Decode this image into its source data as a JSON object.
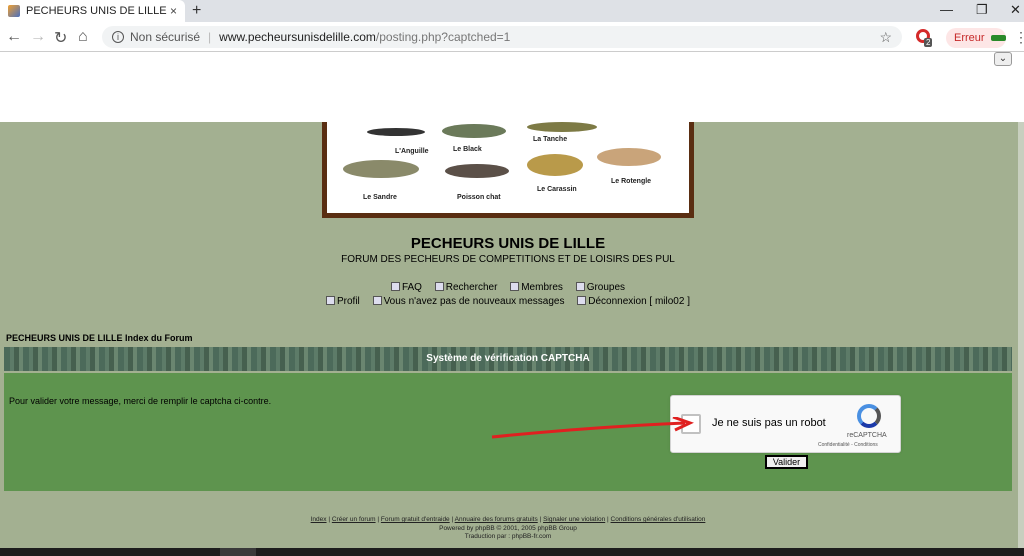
{
  "browser": {
    "tab_title": "PECHEURS UNIS DE LILLE ::",
    "tab_close": "×",
    "new_tab": "+",
    "security": "Non sécurisé",
    "url_host": "www.pecheursunisdelille.com",
    "url_path": "/posting.php?captched=1",
    "error_label": "Erreur",
    "ext_badge": "2"
  },
  "banner": {
    "fish_labels": [
      "L'Anguille",
      "Le Black",
      "La Tanche",
      "Le Sandre",
      "Poisson chat",
      "Le Carassin",
      "Le Rotengle"
    ]
  },
  "site": {
    "title": "PECHEURS UNIS DE LILLE",
    "description": "FORUM DES PECHEURS DE COMPETITIONS ET DE LOISIRS DES PUL"
  },
  "nav": {
    "faq": "FAQ",
    "search": "Rechercher",
    "members": "Membres",
    "groups": "Groupes",
    "profile": "Profil",
    "messages": "Vous n'avez pas de nouveaux messages",
    "logout": "Déconnexion [ milo02 ]"
  },
  "breadcrumb": "PECHEURS UNIS DE LILLE Index du Forum",
  "captcha": {
    "header": "Système de vérification CAPTCHA",
    "message": "Pour valider votre message, merci de remplir le captcha ci-contre.",
    "checkbox_label": "Je ne suis pas un robot",
    "brand": "reCAPTCHA",
    "terms": "Confidentialité - Conditions",
    "submit": "Valider"
  },
  "footer": {
    "links": [
      "Index",
      "Créer un forum",
      "Forum gratuit d'entraide",
      "Annuaire des forums gratuits",
      "Signaler une violation",
      "Conditions générales d'utilisation"
    ],
    "powered": "Powered by phpBB © 2001, 2005 phpBB Group",
    "translation": "Traduction par : phpBB-fr.com"
  },
  "colors": {
    "page_bg": "#a3b091",
    "panel_green": "#5e944e",
    "banner_frame": "#5a2e12",
    "arrow_red": "#e02020"
  }
}
